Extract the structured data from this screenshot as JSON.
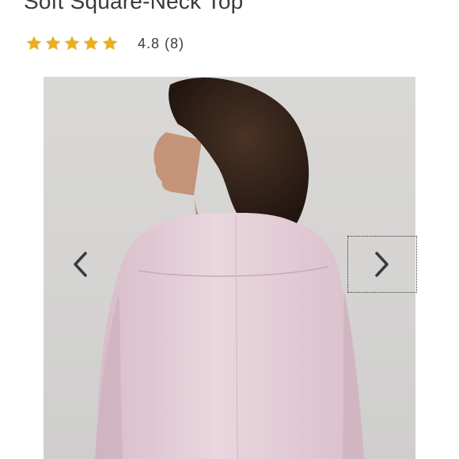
{
  "product": {
    "title": "Soft Square-Neck Top",
    "rating_value": 4.8,
    "rating_text": "4.8 (8)",
    "stars": 5
  },
  "gallery": {
    "prev_icon": "chevron-left-icon",
    "next_icon": "chevron-right-icon"
  },
  "colors": {
    "star": "#e8b022",
    "text": "#3a3a3a",
    "top_fabric": "#e6cfd9",
    "background": "#d6d5d4"
  }
}
